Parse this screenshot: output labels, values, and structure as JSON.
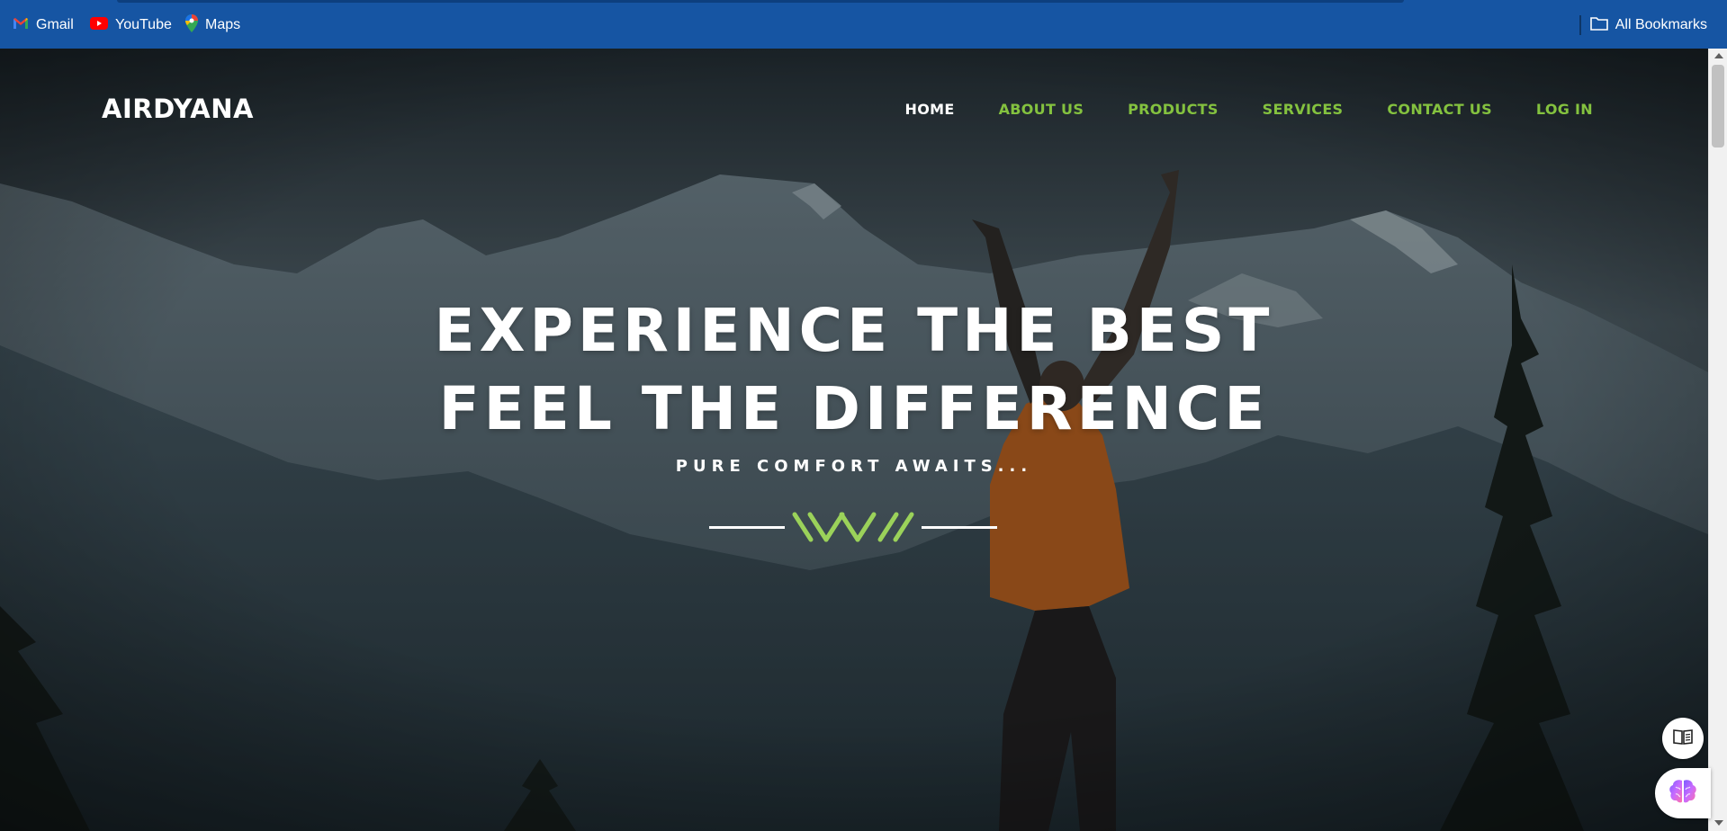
{
  "bookmarks": {
    "items": [
      {
        "label": "Gmail",
        "icon": "gmail-icon"
      },
      {
        "label": "YouTube",
        "icon": "youtube-icon"
      },
      {
        "label": "Maps",
        "icon": "maps-icon"
      }
    ],
    "all_bookmarks": "All Bookmarks"
  },
  "site": {
    "brand": "AIRDYANA",
    "nav": [
      {
        "label": "HOME",
        "active": true
      },
      {
        "label": "ABOUT US",
        "active": false
      },
      {
        "label": "PRODUCTS",
        "active": false
      },
      {
        "label": "SERVICES",
        "active": false
      },
      {
        "label": "CONTACT US",
        "active": false
      },
      {
        "label": "LOG IN",
        "active": false
      }
    ]
  },
  "hero": {
    "line1": "EXPERIENCE THE BEST",
    "line2": "FEEL THE DIFFERENCE",
    "tagline": "PURE COMFORT AWAITS..."
  },
  "colors": {
    "accent": "#84c23f",
    "bookmarks_bar": "#1655a3"
  }
}
